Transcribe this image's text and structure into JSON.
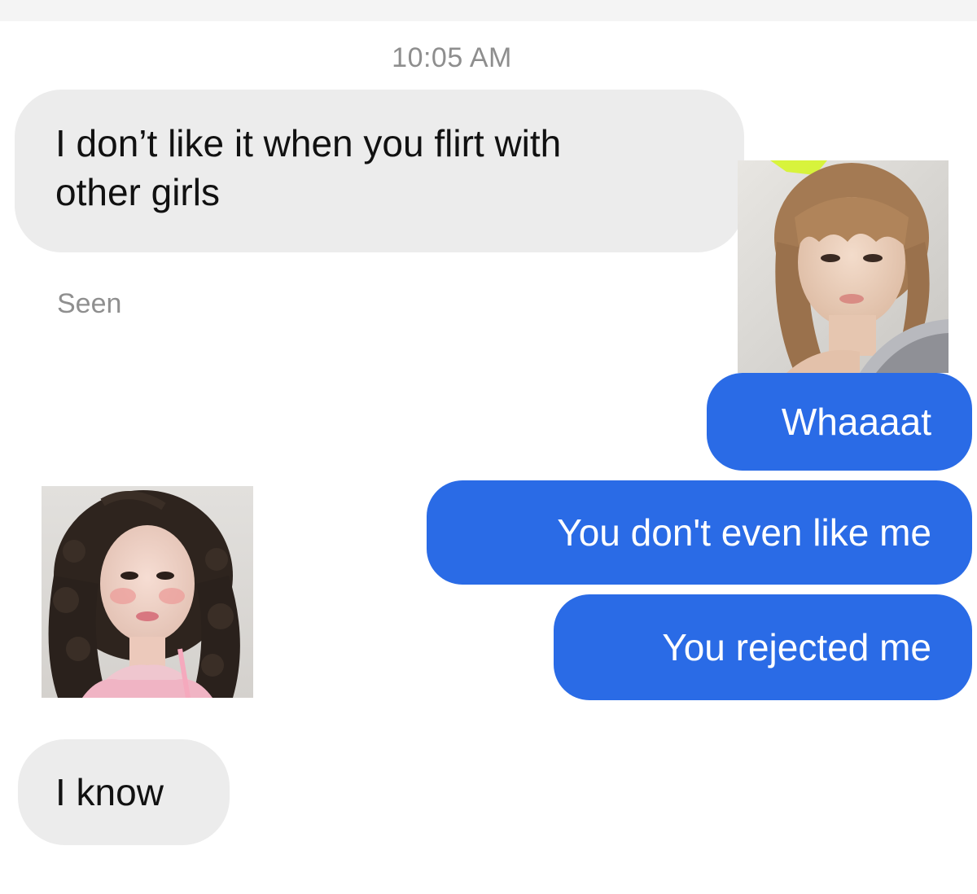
{
  "chat": {
    "timestamp": "10:05 AM",
    "messages": [
      {
        "sender": "them",
        "line1": "I don’t like it when you flirt with",
        "line2": "other girls"
      },
      {
        "sender": "me",
        "text": "Whaaaat"
      },
      {
        "sender": "me",
        "text": "You don't even like me"
      },
      {
        "sender": "me",
        "text": "You rejected me"
      },
      {
        "sender": "them",
        "text": "I know"
      }
    ],
    "read_receipt": "Seen"
  },
  "colors": {
    "received_bubble": "#ececec",
    "sent_bubble": "#2a6be6",
    "timestamp_text": "#8e8e8e"
  },
  "overlays": [
    {
      "name": "photo-light-brown-hair-bangs"
    },
    {
      "name": "photo-dark-curly-hair"
    }
  ]
}
